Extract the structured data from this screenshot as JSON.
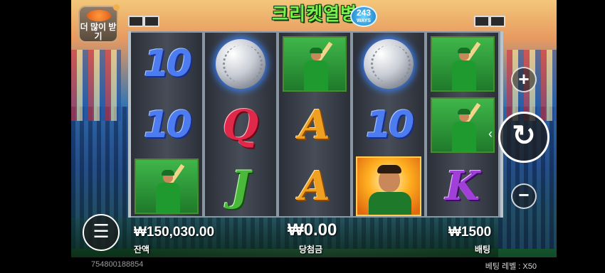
{
  "header": {
    "title": "크리켓열병",
    "ways_value": "243",
    "ways_label": "WAYS",
    "more_button_label": "더 많이 받기"
  },
  "reels": [
    [
      "10",
      "10",
      "player"
    ],
    [
      "ball",
      "Q",
      "J"
    ],
    [
      "player",
      "A",
      "A"
    ],
    [
      "ball",
      "10",
      "captain"
    ],
    [
      "player",
      "player",
      "K"
    ]
  ],
  "controls": {
    "plus": "+",
    "minus": "−",
    "spin": "↻",
    "menu": "☰",
    "collapse": "‹"
  },
  "status": {
    "balance_value": "₩150,030.00",
    "balance_label": "잔액",
    "win_value": "₩0.00",
    "win_label": "당첨금",
    "bet_value": "₩1500",
    "bet_label": "배팅"
  },
  "footer": {
    "round_id": "754800188854",
    "bet_level": "베팅 레벨 : X50"
  },
  "icons": {
    "spin": "refresh-icon",
    "menu": "hamburger-icon",
    "ball": "cricket-ball-icon",
    "player": "batsman-icon",
    "captain": "captain-icon"
  }
}
